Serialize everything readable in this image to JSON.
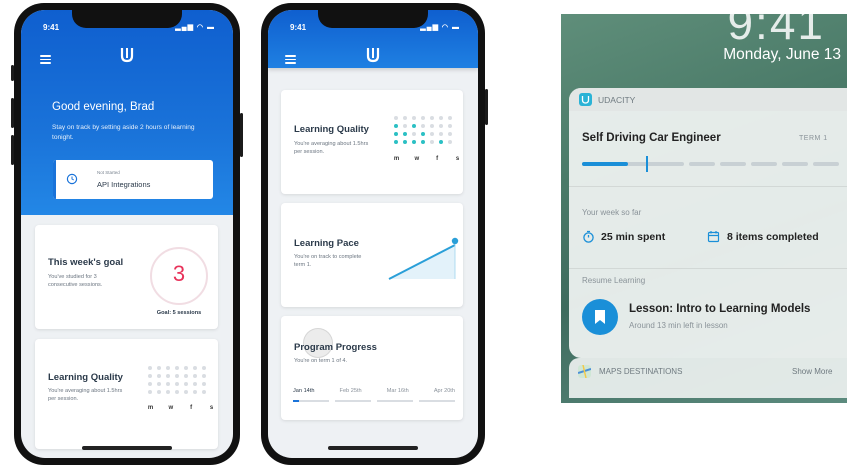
{
  "phone1": {
    "time": "9:41",
    "greeting": "Good evening, Brad",
    "message": "Stay on track by setting aside 2 hours of learning tonight.",
    "lesson_card": {
      "status": "Not Started",
      "title": "API Integrations"
    },
    "goal_card": {
      "title": "This week's goal",
      "text": "You've studied for 3 consecutive sessions.",
      "count": "3",
      "goal_label": "Goal: 5 sessions"
    },
    "quality_card": {
      "title": "Learning Quality",
      "text": "You're averaging about 1.5hrs per session.",
      "days": [
        "m",
        "w",
        "f",
        "s"
      ]
    }
  },
  "phone2": {
    "time": "9:41",
    "quality_card": {
      "title": "Learning Quality",
      "text": "You're averaging about 1.5hrs per session.",
      "days": [
        "m",
        "w",
        "f",
        "s"
      ]
    },
    "pace_card": {
      "title": "Learning Pace",
      "text": "You're on track to complete term 1."
    },
    "progress_card": {
      "title": "Program Progress",
      "text": "You're on term 1 of 4.",
      "months": [
        "Jan 14th",
        "Feb 25th",
        "Mar 16th",
        "Apr 20th"
      ]
    }
  },
  "notification": {
    "clock": "9:41",
    "date": "Monday, June 13",
    "app_name": "UDACITY",
    "program_title": "Self Driving Car Engineer",
    "term": "TERM 1",
    "week_label": "Your week so far",
    "time_spent": "25 min spent",
    "items_completed": "8 items completed",
    "resume_label": "Resume Learning",
    "lesson_title": "Lesson: Intro to Learning Models",
    "lesson_sub": "Around 13 min left in lesson",
    "maps_label": "MAPS DESTINATIONS",
    "show_more": "Show More"
  },
  "colors": {
    "brand_blue": "#1a73d9",
    "accent_teal": "#2bc0c4",
    "goal_pink": "#e8325a"
  }
}
